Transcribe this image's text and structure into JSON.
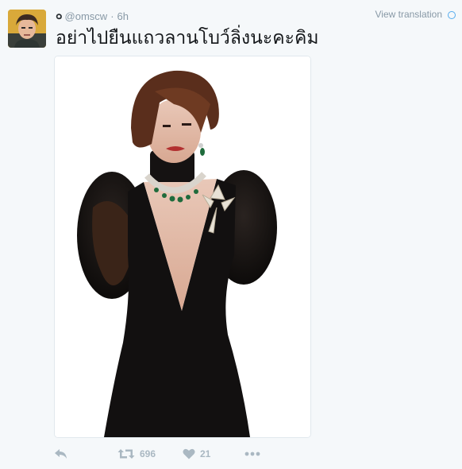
{
  "tweet": {
    "name_glyph": "๐",
    "handle": "@omscw",
    "separator": "·",
    "time": "6h",
    "text": "อย่าไปยืนแถวลานโบว์ลิ่งนะคะคิม",
    "view_translation": "View translation"
  },
  "actions": {
    "retweet_count": "696",
    "like_count": "21"
  },
  "icons": {
    "reply": "reply-icon",
    "retweet": "retweet-icon",
    "like": "heart-icon",
    "more": "more-icon",
    "globe": "globe-icon"
  },
  "colors": {
    "background": "#f5f8fa",
    "muted": "#8899a6",
    "action_icon": "#aab8c2",
    "accent": "#55acee"
  }
}
